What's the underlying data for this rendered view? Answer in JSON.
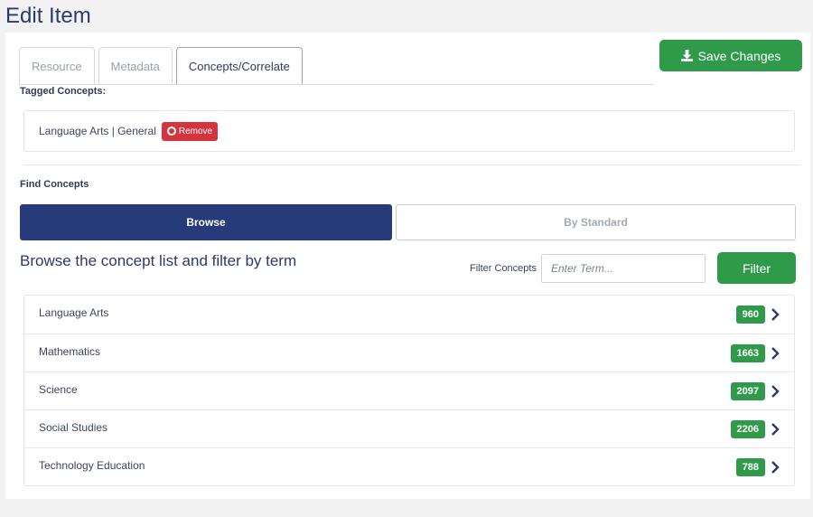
{
  "page": {
    "title": "Edit Item"
  },
  "tabs": [
    {
      "label": "Resource",
      "active": false
    },
    {
      "label": "Metadata",
      "active": false
    },
    {
      "label": "Concepts/Correlate",
      "active": true
    }
  ],
  "save_button": {
    "label": "Save Changes",
    "icon": "download-icon"
  },
  "tagged": {
    "heading": "Tagged Concepts:",
    "items": [
      {
        "label": "Language Arts | General",
        "remove_label": "Remove"
      }
    ]
  },
  "find": {
    "heading": "Find Concepts",
    "modes": [
      {
        "label": "Browse",
        "active": true
      },
      {
        "label": "By Standard",
        "active": false
      }
    ],
    "browse_heading": "Browse the concept list and filter by term",
    "filter_label": "Filter Concepts",
    "filter_placeholder": "Enter Term...",
    "filter_value": "",
    "filter_button": "Filter"
  },
  "concepts": [
    {
      "name": "Language Arts",
      "count": "960"
    },
    {
      "name": "Mathematics",
      "count": "1663"
    },
    {
      "name": "Science",
      "count": "2097"
    },
    {
      "name": "Social Studies",
      "count": "2206"
    },
    {
      "name": "Technology Education",
      "count": "788"
    }
  ],
  "colors": {
    "brand_navy": "#273a7a",
    "success_green": "#2e9a4a",
    "danger_red": "#d5343f",
    "background": "#f2f2f3"
  }
}
